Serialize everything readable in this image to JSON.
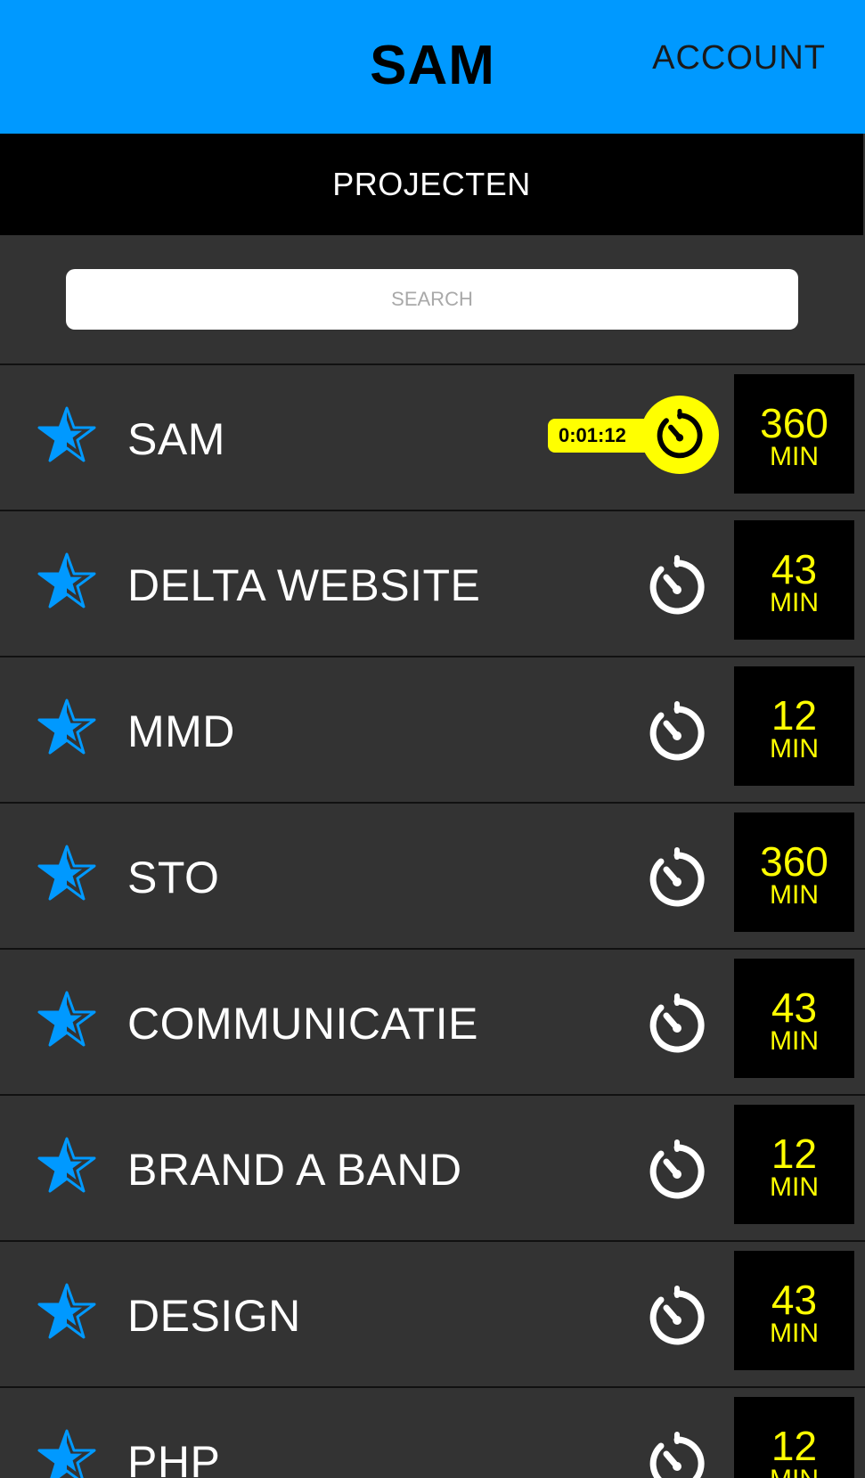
{
  "header": {
    "title": "SAM",
    "account_label": "ACCOUNT"
  },
  "tabs": {
    "active_label": "PROJECTEN"
  },
  "search": {
    "placeholder": "SEARCH",
    "value": ""
  },
  "colors": {
    "header_bg": "#0099ff",
    "list_bg": "#333333",
    "accent_yellow": "#ffff00",
    "star_blue": "#0099ff"
  },
  "projects": [
    {
      "name": "SAM",
      "minutes": "360",
      "unit": "MIN",
      "active": true,
      "elapsed": "0:01:12",
      "favorite": true
    },
    {
      "name": "DELTA WEBSITE",
      "minutes": "43",
      "unit": "MIN",
      "active": false,
      "favorite": true
    },
    {
      "name": "MMD",
      "minutes": "12",
      "unit": "MIN",
      "active": false,
      "favorite": true
    },
    {
      "name": "STO",
      "minutes": "360",
      "unit": "MIN",
      "active": false,
      "favorite": true
    },
    {
      "name": "COMMUNICATIE",
      "minutes": "43",
      "unit": "MIN",
      "active": false,
      "favorite": true
    },
    {
      "name": "BRAND A BAND",
      "minutes": "12",
      "unit": "MIN",
      "active": false,
      "favorite": true
    },
    {
      "name": "DESIGN",
      "minutes": "43",
      "unit": "MIN",
      "active": false,
      "favorite": true
    },
    {
      "name": "PHP",
      "minutes": "12",
      "unit": "MIN",
      "active": false,
      "favorite": true
    }
  ],
  "icons": {
    "favorite": "star-half-filled-icon",
    "timer": "stopwatch-icon"
  }
}
